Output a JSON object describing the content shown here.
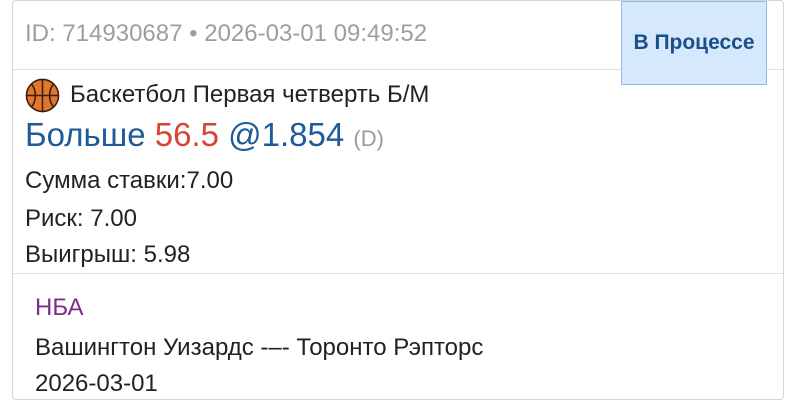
{
  "bet": {
    "id_label": "ID: 714930687",
    "separator": "•",
    "datetime": "2026-03-01 09:49:52",
    "status": "В Процессе",
    "status_color": "#1b4f8a",
    "status_bg": "#d6e8fb"
  },
  "market": {
    "icon": "basketball-icon",
    "name": "Баскетбол Первая четверть Б/М"
  },
  "selection": {
    "name": "Больше",
    "line": "56.5",
    "odds": "@1.854",
    "odds_type": "(D)",
    "name_color": "#1f5a99",
    "line_color": "#d84334"
  },
  "details": {
    "stake": "Сумма ставки:7.00",
    "risk": "Риск: 7.00",
    "win": "Выигрыш: 5.98"
  },
  "event": {
    "league": "НБА",
    "league_color": "#7a2d8c",
    "teams": "Вашингтон Уизардс -–- Торонто Рэпторс",
    "date": "2026-03-01"
  }
}
